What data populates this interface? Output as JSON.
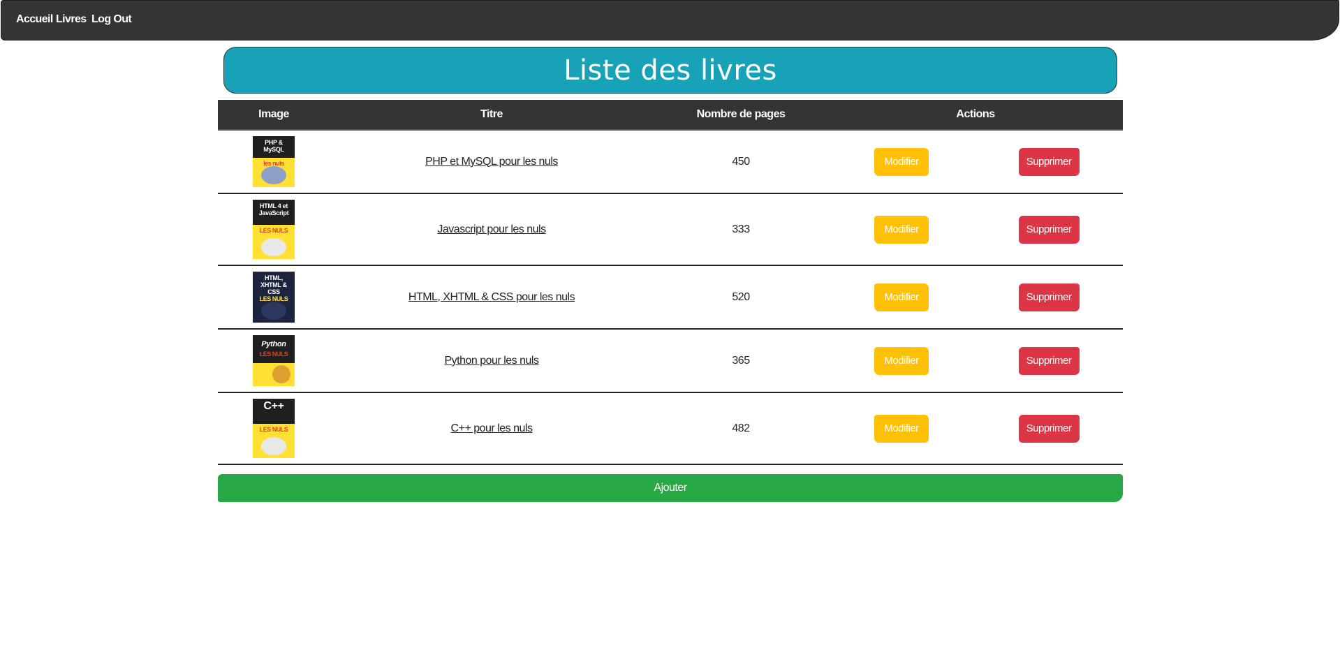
{
  "nav": {
    "links": [
      "Accueil",
      "Livres",
      "Log Out"
    ]
  },
  "page": {
    "title": "Liste des livres"
  },
  "table": {
    "headers": {
      "image": "Image",
      "title": "Titre",
      "pages": "Nombre de pages",
      "actions": "Actions"
    },
    "rows": [
      {
        "title": "PHP et MySQL pour les nuls",
        "pages": "450",
        "modify": "Modifier",
        "delete": "Supprimer",
        "cover_text": "PHP & MySQL",
        "cover_sub": "les nuls"
      },
      {
        "title": "Javascript pour les nuls",
        "pages": "333",
        "modify": "Modifier",
        "delete": "Supprimer",
        "cover_text": "HTML 4 et JavaScript",
        "cover_sub": "LES NULS"
      },
      {
        "title": "HTML, XHTML & CSS pour les nuls",
        "pages": "520",
        "modify": "Modifier",
        "delete": "Supprimer",
        "cover_text": "HTML, XHTML & CSS",
        "cover_sub": "LES NULS"
      },
      {
        "title": "Python pour les nuls",
        "pages": "365",
        "modify": "Modifier",
        "delete": "Supprimer",
        "cover_text": "Python",
        "cover_sub": "LES NULS"
      },
      {
        "title": "C++ pour les nuls",
        "pages": "482",
        "modify": "Modifier",
        "delete": "Supprimer",
        "cover_text": "C++",
        "cover_sub": "LES NULS"
      }
    ]
  },
  "add_button": "Ajouter",
  "colors": {
    "navbar": "#343434",
    "title_box": "#17a2b8",
    "modify": "#ffc107",
    "delete": "#dc3545",
    "add": "#28a745"
  }
}
